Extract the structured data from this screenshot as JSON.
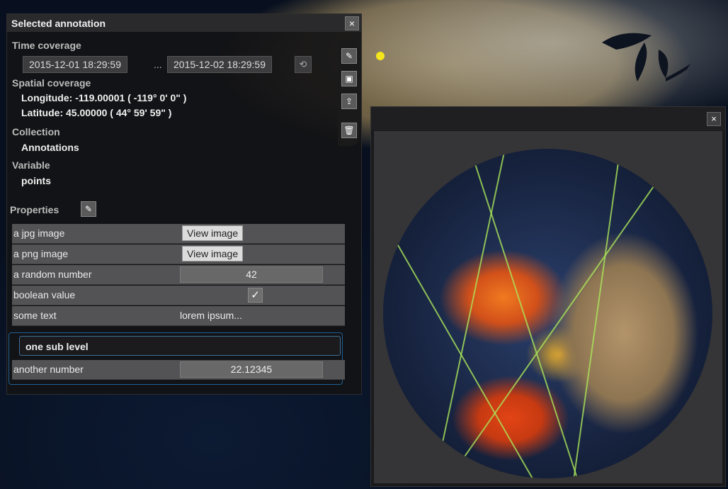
{
  "panel": {
    "title": "Selected annotation",
    "close_icon": "×",
    "time_coverage_label": "Time coverage",
    "time_start": "2015-12-01 18:29:59",
    "time_separator": "...",
    "time_end": "2015-12-02 18:29:59",
    "spatial_coverage_label": "Spatial coverage",
    "longitude": "Longitude: -119.00001 ( -119° 0' 0\" )",
    "latitude": "Latitude: 45.00000 ( 44° 59' 59\" )",
    "collection_label": "Collection",
    "collection_value": "Annotations",
    "variable_label": "Variable",
    "variable_value": "points",
    "properties_label": "Properties",
    "properties": [
      {
        "name": "a jpg image",
        "button": "View image"
      },
      {
        "name": "a png image",
        "button": "View image"
      },
      {
        "name": "a random number",
        "value": "42"
      },
      {
        "name": "boolean value",
        "checked": true
      },
      {
        "name": "some text",
        "value": "lorem ipsum..."
      }
    ],
    "sub_level_title": "one sub level",
    "sub_properties": [
      {
        "name": "another number",
        "value": "22.12345"
      }
    ]
  },
  "toolbar": {
    "icons": [
      "pencil-icon",
      "save-icon",
      "export-icon",
      "trash-icon"
    ]
  },
  "globe_window": {
    "close_icon": "×"
  },
  "colors": {
    "accent": "#1e5f93",
    "marker": "#f5e51e"
  }
}
